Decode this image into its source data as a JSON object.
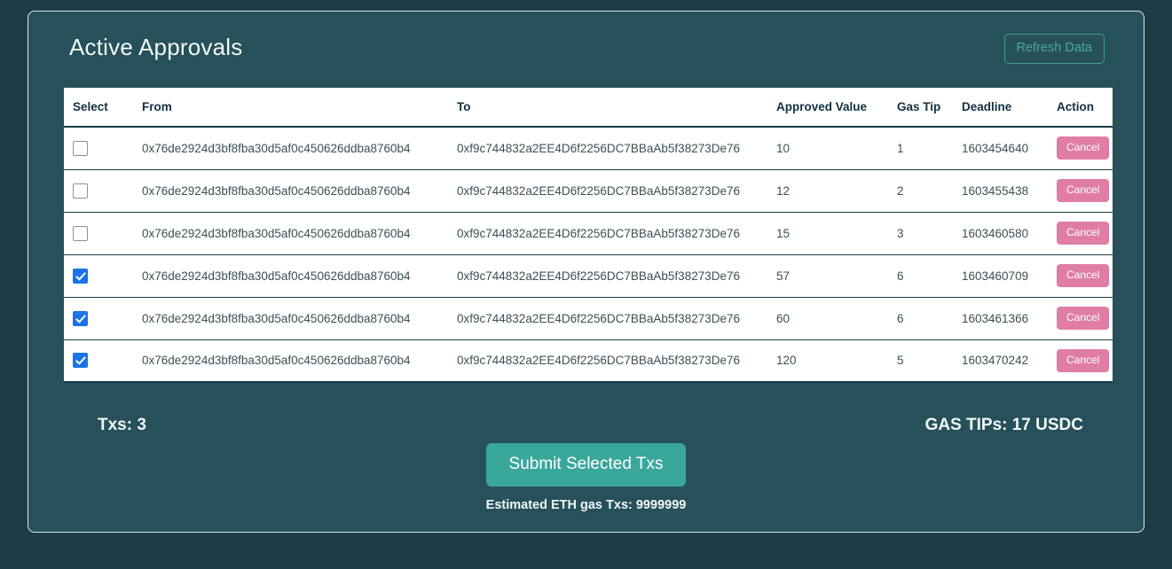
{
  "header": {
    "title": "Active Approvals",
    "refresh_label": "Refresh Data"
  },
  "table": {
    "columns": [
      "Select",
      "From",
      "To",
      "Approved Value",
      "Gas Tip",
      "Deadline",
      "Action"
    ],
    "rows": [
      {
        "selected": false,
        "from": "0x76de2924d3bf8fba30d5af0c450626ddba8760b4",
        "to": "0xf9c744832a2EE4D6f2256DC7BBaAb5f38273De76",
        "approved_value": "10",
        "gas_tip": "1",
        "deadline": "1603454640",
        "action_label": "Cancel"
      },
      {
        "selected": false,
        "from": "0x76de2924d3bf8fba30d5af0c450626ddba8760b4",
        "to": "0xf9c744832a2EE4D6f2256DC7BBaAb5f38273De76",
        "approved_value": "12",
        "gas_tip": "2",
        "deadline": "1603455438",
        "action_label": "Cancel"
      },
      {
        "selected": false,
        "from": "0x76de2924d3bf8fba30d5af0c450626ddba8760b4",
        "to": "0xf9c744832a2EE4D6f2256DC7BBaAb5f38273De76",
        "approved_value": "15",
        "gas_tip": "3",
        "deadline": "1603460580",
        "action_label": "Cancel"
      },
      {
        "selected": true,
        "from": "0x76de2924d3bf8fba30d5af0c450626ddba8760b4",
        "to": "0xf9c744832a2EE4D6f2256DC7BBaAb5f38273De76",
        "approved_value": "57",
        "gas_tip": "6",
        "deadline": "1603460709",
        "action_label": "Cancel"
      },
      {
        "selected": true,
        "from": "0x76de2924d3bf8fba30d5af0c450626ddba8760b4",
        "to": "0xf9c744832a2EE4D6f2256DC7BBaAb5f38273De76",
        "approved_value": "60",
        "gas_tip": "6",
        "deadline": "1603461366",
        "action_label": "Cancel"
      },
      {
        "selected": true,
        "from": "0x76de2924d3bf8fba30d5af0c450626ddba8760b4",
        "to": "0xf9c744832a2EE4D6f2256DC7BBaAb5f38273De76",
        "approved_value": "120",
        "gas_tip": "5",
        "deadline": "1603470242",
        "action_label": "Cancel"
      }
    ]
  },
  "footer": {
    "txs_count": "Txs: 3",
    "gas_tips_total": "GAS TIPs: 17 USDC",
    "submit_label": "Submit Selected Txs",
    "estimated_gas": "Estimated ETH gas Txs: 9999999"
  },
  "colors": {
    "page_background": "#1d3c45",
    "card_background": "#27505a",
    "accent_teal": "#3aa79b",
    "cancel_pink": "#e07da5",
    "checkbox_blue": "#1a73e8",
    "table_background": "#ffffff",
    "header_text": "#123040"
  }
}
